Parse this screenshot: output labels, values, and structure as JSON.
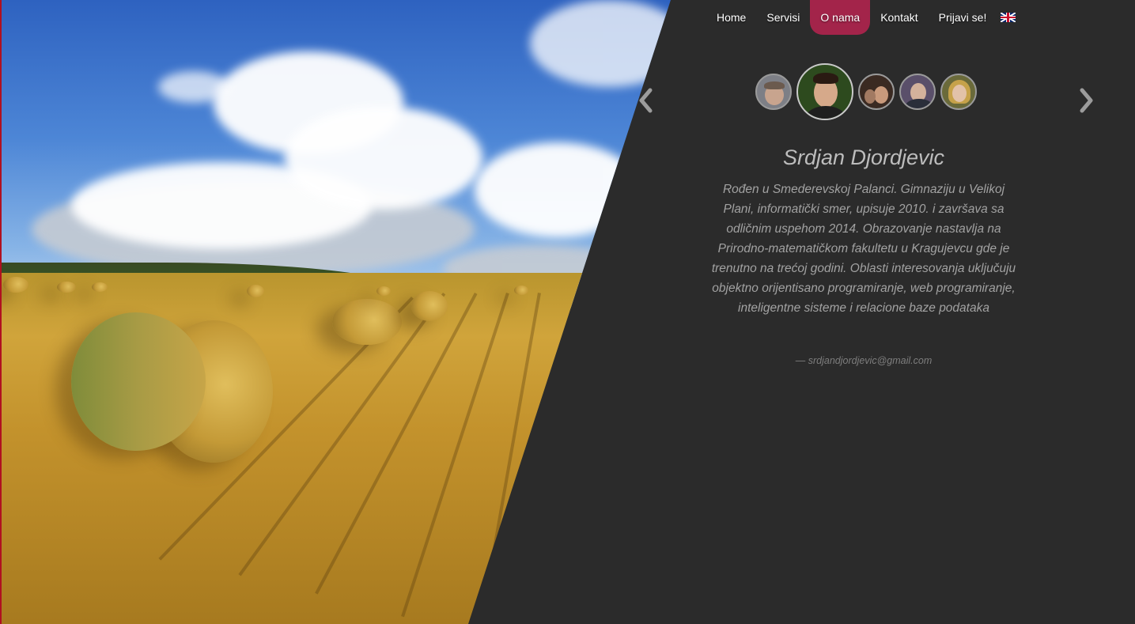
{
  "nav": {
    "items": [
      {
        "label": "Home",
        "active": false
      },
      {
        "label": "Servisi",
        "active": false
      },
      {
        "label": "O nama",
        "active": true
      },
      {
        "label": "Kontakt",
        "active": false
      },
      {
        "label": "Prijavi se!",
        "active": false
      }
    ],
    "language_icon": "uk-flag-icon",
    "active_color": "#a3244a"
  },
  "carousel": {
    "prev_icon": "chevron-left-icon",
    "next_icon": "chevron-right-icon",
    "avatar_count": 5,
    "active_index": 1
  },
  "profile": {
    "name": "Srdjan Djordjevic",
    "bio": "Rođen u Smederevskoj Palanci. Gimnaziju u Velikoj Plani, informatički smer, upisuje 2010. i završava sa odličnim uspehom 2014. Obrazovanje nastavlja na Prirodno-matematičkom fakultetu u Kragujevcu gde je trenutno na trećoj godini. Oblasti interesovanja uključuju objektno orijentisano programiranje, web programiranje, inteligentne sisteme i relacione baze podataka",
    "email": "— srdjandjordjevic@gmail.com"
  },
  "colors": {
    "panel_background": "#2b2b2b",
    "name_text": "#bdbdbd",
    "bio_text": "#a2a2a2"
  }
}
